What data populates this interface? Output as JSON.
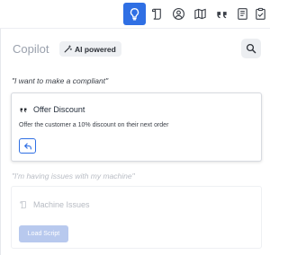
{
  "toolbar": {
    "icons": [
      "lightbulb-icon",
      "script-icon",
      "user-circle-icon",
      "map-icon",
      "quote-icon",
      "document-icon",
      "clipboard-check-icon"
    ],
    "active_color": "#2f6fe4"
  },
  "header": {
    "title": "Copilot",
    "badge": "AI powered"
  },
  "conversation": [
    {
      "query": "\"I want to make a compliant\"",
      "card": {
        "title": "Offer Discount",
        "description": "Offer the customer a 10% discount on their next order"
      }
    },
    {
      "query": "\"I'm having issues with my machine\"",
      "card": {
        "title": "Machine Issues",
        "button": "Load Script"
      }
    }
  ],
  "colors": {
    "accent": "#2f6fe4",
    "disabled_button": "#b8c9ee",
    "muted_text": "#9aa1ad"
  }
}
